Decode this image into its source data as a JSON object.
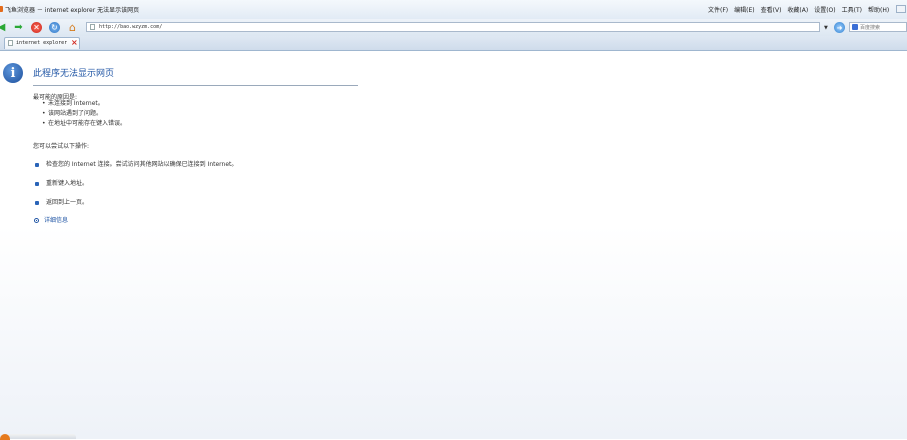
{
  "window": {
    "title": "飞鱼浏览器 － internet explorer 无法显示该网页",
    "menu": [
      "文件(F)",
      "编辑(E)",
      "查看(V)",
      "收藏(A)",
      "设置(O)",
      "工具(T)",
      "帮助(H)"
    ]
  },
  "navbar": {
    "url": "http://bao.wzyzm.com/",
    "search_placeholder": "百度搜索"
  },
  "tabs": [
    {
      "label": "internet explorer"
    }
  ],
  "content": {
    "title": "此程序无法显示网页",
    "reasons_heading": "最可能的原因是:",
    "reasons": [
      "未连接到 Internet。",
      "该网站遇到了问题。",
      "在地址中可能存在键入错误。"
    ],
    "actions_heading": "您可以尝试以下操作:",
    "actions": [
      "检查您的 Internet 连接。尝试访问其他网站以确保已连接到 Internet。",
      "重新键入地址。",
      "返回到上一页。"
    ],
    "details_label": "详细信息"
  },
  "colors": {
    "link": "#2156a5",
    "accent_bullet": "#2a64b8",
    "stop": "#c9261c",
    "nav_green": "#2aa835"
  },
  "icons": {
    "info": "info-icon",
    "back": "back-arrow-icon",
    "forward": "forward-arrow-icon",
    "stop": "stop-icon",
    "refresh": "refresh-icon",
    "home": "home-icon"
  }
}
